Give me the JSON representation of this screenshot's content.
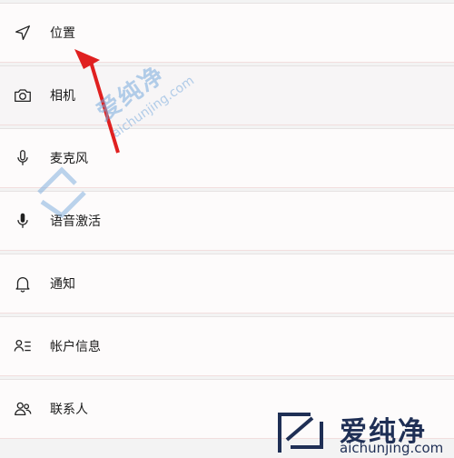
{
  "settings_list": {
    "items": [
      {
        "label": "位置",
        "icon": "location-arrow-icon"
      },
      {
        "label": "相机",
        "icon": "camera-icon"
      },
      {
        "label": "麦克风",
        "icon": "microphone-icon"
      },
      {
        "label": "语音激活",
        "icon": "microphone-filled-icon"
      },
      {
        "label": "通知",
        "icon": "bell-icon"
      },
      {
        "label": "帐户信息",
        "icon": "account-info-icon"
      },
      {
        "label": "联系人",
        "icon": "contacts-icon"
      }
    ]
  },
  "watermark": {
    "brand": "爱纯净",
    "url": "aichunjing.com",
    "color_center": "#78aadc",
    "color_corner": "#1f2f55"
  },
  "annotation": {
    "arrow_color": "#e02020"
  }
}
